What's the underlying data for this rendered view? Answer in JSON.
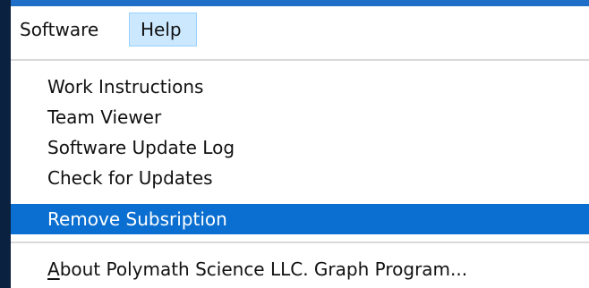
{
  "menubar": {
    "items": [
      {
        "label": "Software"
      },
      {
        "label": "Help"
      }
    ],
    "active": "Help"
  },
  "dropdown": {
    "items": [
      {
        "label": "Work Instructions"
      },
      {
        "label": "Team Viewer"
      },
      {
        "label": "Software Update Log"
      },
      {
        "label": "Check for Updates"
      },
      {
        "label": "Remove Subsription",
        "selected": true
      }
    ],
    "about": {
      "label_first_char": "A",
      "label_rest": "bout Polymath Science LLC. Graph Program..."
    }
  },
  "colors": {
    "selection": "#0a6fd0",
    "menubar_active": "#cce8ff",
    "accent": "#1f6fc8"
  }
}
